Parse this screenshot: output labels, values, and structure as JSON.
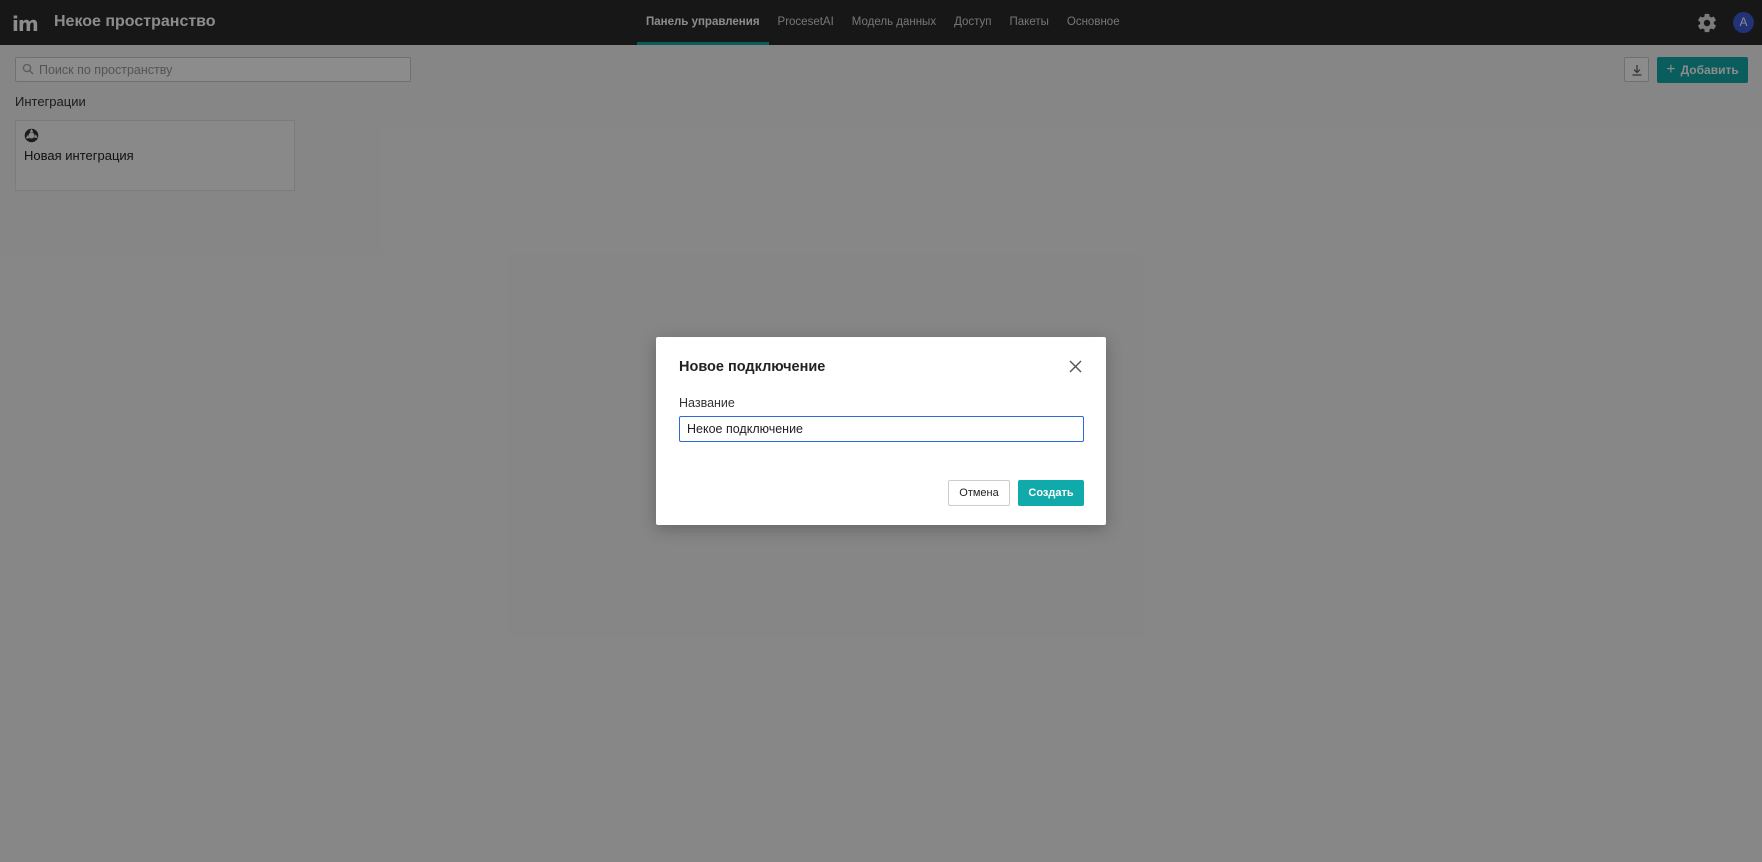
{
  "header": {
    "logo": "im",
    "title": "Некое пространство",
    "nav": [
      {
        "label": "Панель управления",
        "active": true
      },
      {
        "label": "ProcesetAI",
        "active": false
      },
      {
        "label": "Модель данных",
        "active": false
      },
      {
        "label": "Доступ",
        "active": false
      },
      {
        "label": "Пакеты",
        "active": false
      },
      {
        "label": "Основное",
        "active": false
      }
    ],
    "settings_icon": "gear-icon",
    "avatar_initial": "A"
  },
  "toolbar": {
    "search_placeholder": "Поиск по пространству",
    "download_icon": "download-icon",
    "add_label": "Добавить",
    "add_icon": "plus-icon"
  },
  "integrations": {
    "section_label": "Интеграции",
    "items": [
      {
        "title": "Новая интеграция",
        "icon": "integration-icon"
      }
    ]
  },
  "modal": {
    "title": "Новое подключение",
    "field_label": "Название",
    "field_value": "Некое подключение",
    "cancel_label": "Отмена",
    "create_label": "Создать"
  },
  "colors": {
    "accent": "#11aaaa",
    "topbar": "#2b2b2b",
    "avatar": "#3d5bd9",
    "input_focus": "#2a6cd4"
  }
}
